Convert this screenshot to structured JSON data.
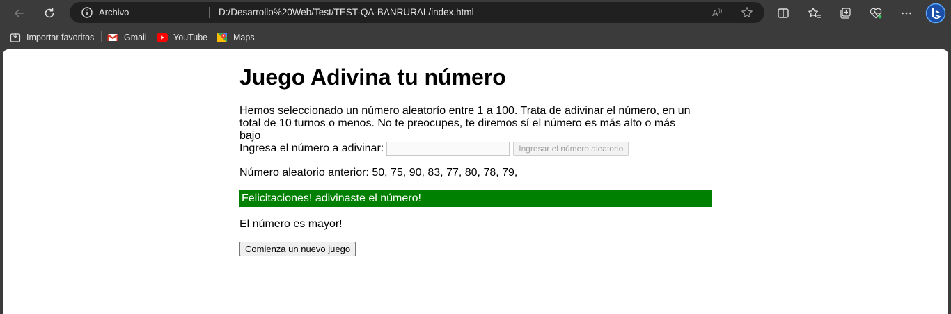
{
  "browser": {
    "site_label": "Archivo",
    "url": "D:/Desarrollo%20Web/Test/TEST-QA-BANRURAL/index.html",
    "icons": [
      "back-icon",
      "reload-icon",
      "info-icon",
      "read-aloud-icon",
      "favorite-star-icon",
      "split-screen-icon",
      "favorites-icon",
      "collections-icon",
      "performance-icon",
      "more-icon",
      "bing-icon"
    ],
    "bookmarks": [
      {
        "label": "Importar favoritos",
        "icon": "import-icon"
      },
      {
        "label": "Gmail",
        "icon": "gmail-icon"
      },
      {
        "label": "YouTube",
        "icon": "youtube-icon"
      },
      {
        "label": "Maps",
        "icon": "maps-icon"
      }
    ]
  },
  "page": {
    "title": "Juego Adivina tu número",
    "description": "Hemos seleccionado un número aleatorío entre 1 a 100. Trata de adivinar el número, en un total de 10 turnos o menos. No te preocupes, te diremos sí el número es más alto o más bajo",
    "guess_label": "Ingresa el número a adivinar:",
    "guess_input_value": "",
    "submit_label": "Ingresar el número aleatorio",
    "previous_guesses": "Número aleatorio anterior: 50, 75, 90, 83, 77, 80, 78, 79,",
    "result_message": "Felicitaciones! adivinaste el número!",
    "hint_message": "El número es mayor!",
    "new_game_label": "Comienza un nuevo juego"
  },
  "colors": {
    "success": "#008000",
    "browser_chrome": "#3b3b3b",
    "address_bar": "#202020"
  }
}
